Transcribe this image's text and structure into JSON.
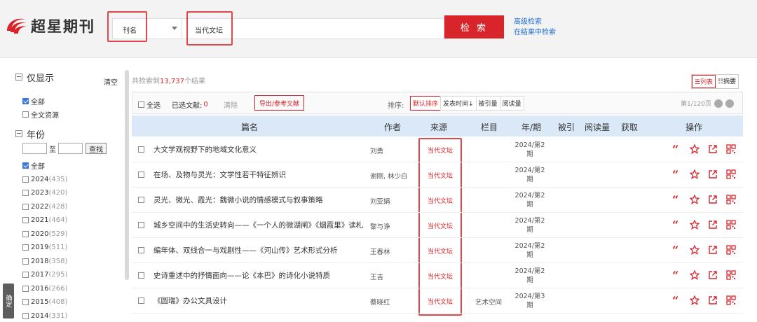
{
  "header": {
    "logo_text": "超星期刊",
    "search_type": "刊名",
    "search_value": "当代文坛",
    "search_button": "检 索",
    "advanced_search": "高级检索",
    "search_in_results": "在结果中检索"
  },
  "sidebar": {
    "only_show": "仅显示",
    "clear": "清空",
    "filters": [
      {
        "label": "全部",
        "checked": true
      },
      {
        "label": "全文资源",
        "checked": false
      }
    ],
    "year_title": "年份",
    "year_to": "至",
    "year_find": "查找",
    "years": [
      {
        "label": "全部",
        "count": "",
        "checked": true
      },
      {
        "label": "2024",
        "count": "(435)",
        "checked": false
      },
      {
        "label": "2023",
        "count": "(420)",
        "checked": false
      },
      {
        "label": "2022",
        "count": "(428)",
        "checked": false
      },
      {
        "label": "2021",
        "count": "(464)",
        "checked": false
      },
      {
        "label": "2020",
        "count": "(529)",
        "checked": false
      },
      {
        "label": "2019",
        "count": "(511)",
        "checked": false
      },
      {
        "label": "2018",
        "count": "(358)",
        "checked": false
      },
      {
        "label": "2017",
        "count": "(295)",
        "checked": false
      },
      {
        "label": "2016",
        "count": "(266)",
        "checked": false
      },
      {
        "label": "2015",
        "count": "(408)",
        "checked": false
      },
      {
        "label": "2014",
        "count": "(331)",
        "checked": false
      }
    ],
    "side_tab": "确定"
  },
  "results": {
    "info_prefix": "共检索到",
    "total": "13,737",
    "info_suffix": "个结果",
    "view_list": "☰列表",
    "view_abstract": "☷摘要"
  },
  "toolbar": {
    "select_all": "全选",
    "selected_label": "已选文献:",
    "selected_count": "0",
    "clear": "清除",
    "export": "导出/参考文献",
    "sort_label": "排序:",
    "sort_options": [
      "默认排序",
      "发表时间↓",
      "被引量",
      "阅读量"
    ],
    "pager": "第1/120页"
  },
  "table_headers": [
    "篇名",
    "作者",
    "来源",
    "栏目",
    "年/期",
    "被引",
    "阅读量",
    "获取",
    "操作"
  ],
  "rows": [
    {
      "title": "大文学观视野下的地域文化意义",
      "author": "刘勇",
      "source": "当代文坛",
      "column": "",
      "period": "2024/第2期"
    },
    {
      "title": "在场、及物与灵光：文学性若干特征辨识",
      "author": "谢刚, 林少白",
      "source": "当代文坛",
      "column": "",
      "period": "2024/第2期"
    },
    {
      "title": "灵光、微光、霞光：魏微小说的情感模式与叙事策略",
      "author": "刘亚娟",
      "source": "当代文坛",
      "column": "",
      "period": "2024/第2期"
    },
    {
      "title": "城乡空间中的生活史转向——《一个人的微湖闸》《烟霞里》读札",
      "author": "黎与诤",
      "source": "当代文坛",
      "column": "",
      "period": "2024/第2期"
    },
    {
      "title": "编年体、双线合一与戏剧性——《河山传》艺术形式分析",
      "author": "王春林",
      "source": "当代文坛",
      "column": "",
      "period": "2024/第2期"
    },
    {
      "title": "史诗重述中的抒情面向——论《本巴》的诗化小说特质",
      "author": "王吉",
      "source": "当代文坛",
      "column": "",
      "period": "2024/第2期"
    },
    {
      "title": "《圆瑞》办公文具设计",
      "author": "蔡晓红",
      "source": "当代文坛",
      "column": "艺术空间",
      "period": "2024/第3期"
    }
  ],
  "colors": {
    "accent": "#d7252b",
    "header_bg": "#f3f3f3",
    "table_head_bg": "#dbe8f7",
    "link": "#1f6fd1"
  }
}
